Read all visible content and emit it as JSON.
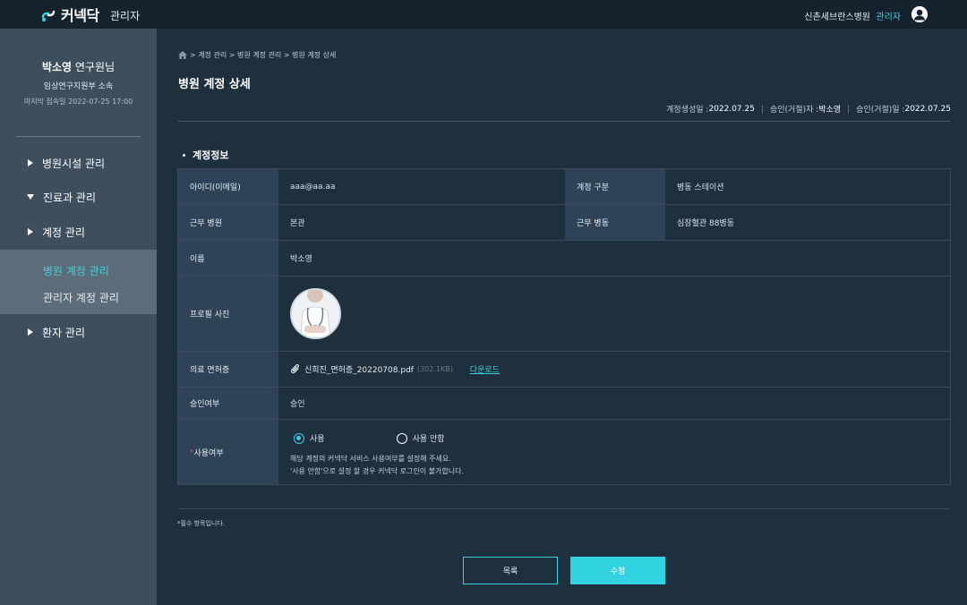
{
  "header": {
    "brand": "커넥닥",
    "section": "관리자",
    "hospital": "신촌세브란스병원",
    "role": "관리자"
  },
  "profile": {
    "name": "박소영",
    "title": "연구원님",
    "department": "임상연구지원부 소속",
    "last_login": "마지막 접속일 2022-07-25 17:00"
  },
  "menu": {
    "items": [
      {
        "label": "병원시설 관리",
        "expanded": false
      },
      {
        "label": "진료과 관리",
        "expanded": true
      },
      {
        "label": "계정 관리",
        "expanded": false
      },
      {
        "label": "환자 관리",
        "expanded": false
      }
    ],
    "sub_items": [
      {
        "label": "병원 계정 관리",
        "active": true
      },
      {
        "label": "관리자 계정 관리",
        "active": false
      }
    ]
  },
  "breadcrumb": "> 계정 관리 > 병원 계정 관리 > 병원 계정 상세",
  "page_title": "병원 계정 상세",
  "meta": {
    "created_label": "계정생성일 : ",
    "created_value": "2022.07.25",
    "approver_label": "승인(거절)자 : ",
    "approver_value": "박소영",
    "approved_label": "승인(거절)일 : ",
    "approved_value": "2022.07.25"
  },
  "section_title": "계정정보",
  "fields": {
    "email_label": "아이디(이메일)",
    "email_value": "aaa@aa.aa",
    "account_type_label": "계정 구분",
    "account_type_value": "병동 스테이션",
    "hospital_label": "근무 병원",
    "hospital_value": "본관",
    "ward_label": "근무 병동",
    "ward_value": "심장혈관 88병동",
    "name_label": "이름",
    "name_value": "박소영",
    "photo_label": "프로필 사진",
    "license_label": "의료 면허증",
    "license_file": "신희진_면허증_20220708.pdf",
    "license_size": "(302.1KB)",
    "download_label": "다운로드",
    "approval_label": "승인여부",
    "approval_value": "승인",
    "use_required_mark": "*",
    "use_label": "사용여부",
    "use_options": [
      "사용",
      "사용 안함"
    ],
    "use_selected": "사용",
    "use_help_1": "해당 계정의 커넥닥 서비스 사용여부를 설정해 주세요.",
    "use_help_2": "'사용 안함'으로 설정 할 경우 커넥닥 로그인이 불가합니다."
  },
  "required_note": "*필수 항목입니다.",
  "buttons": {
    "list": "목록",
    "edit": "수정"
  },
  "colors": {
    "accent": "#3cd1e0",
    "sidebar": "#3d4e5c",
    "background": "#1e2f3d",
    "label_cell": "#2e4357"
  }
}
